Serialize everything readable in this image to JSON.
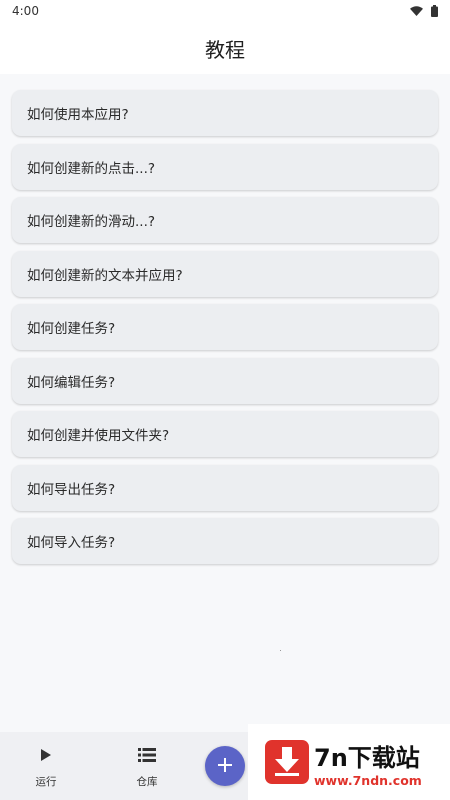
{
  "status_bar": {
    "time": "4:00"
  },
  "header": {
    "title": "教程"
  },
  "tutorials": [
    {
      "label": "如何使用本应用?"
    },
    {
      "label": "如何创建新的点击...?"
    },
    {
      "label": "如何创建新的滑动...?"
    },
    {
      "label": "如何创建新的文本并应用?"
    },
    {
      "label": "如何创建任务?"
    },
    {
      "label": "如何编辑任务?"
    },
    {
      "label": "如何创建并使用文件夹?"
    },
    {
      "label": "如何导出任务?"
    },
    {
      "label": "如何导入任务?"
    }
  ],
  "bottom_nav": {
    "run_label": "运行",
    "library_label": "仓库",
    "fab_icon": "plus-icon"
  },
  "watermark": {
    "title": "7n下载站",
    "url": "www.7ndn.com"
  },
  "colors": {
    "fab": "#5b64c7",
    "watermark_red": "#e0332c",
    "card": "#eceef1"
  }
}
